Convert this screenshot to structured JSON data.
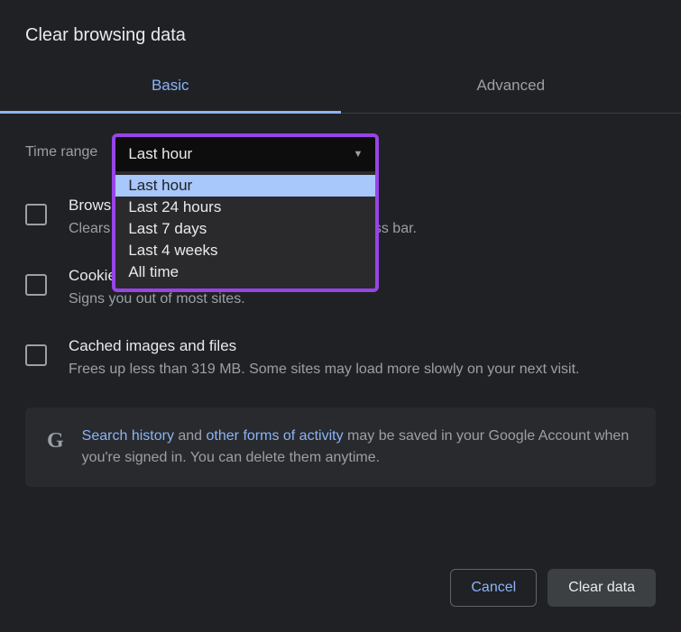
{
  "dialog": {
    "title": "Clear browsing data"
  },
  "tabs": {
    "basic": "Basic",
    "advanced": "Advanced"
  },
  "timeRange": {
    "label": "Time range",
    "selected": "Last hour",
    "options": [
      "Last hour",
      "Last 24 hours",
      "Last 7 days",
      "Last 4 weeks",
      "All time"
    ]
  },
  "items": {
    "browsing": {
      "title": "Browsing history",
      "desc": "Clears history and autocompletions in the address bar."
    },
    "cookies": {
      "title": "Cookies and other site data",
      "desc": "Signs you out of most sites."
    },
    "cached": {
      "title": "Cached images and files",
      "desc": "Frees up less than 319 MB. Some sites may load more slowly on your next visit."
    }
  },
  "info": {
    "gIcon": "G",
    "link1": "Search history",
    "text1": " and ",
    "link2": "other forms of activity",
    "text2": " may be saved in your Google Account when you're signed in. You can delete them anytime."
  },
  "buttons": {
    "cancel": "Cancel",
    "clear": "Clear data"
  }
}
